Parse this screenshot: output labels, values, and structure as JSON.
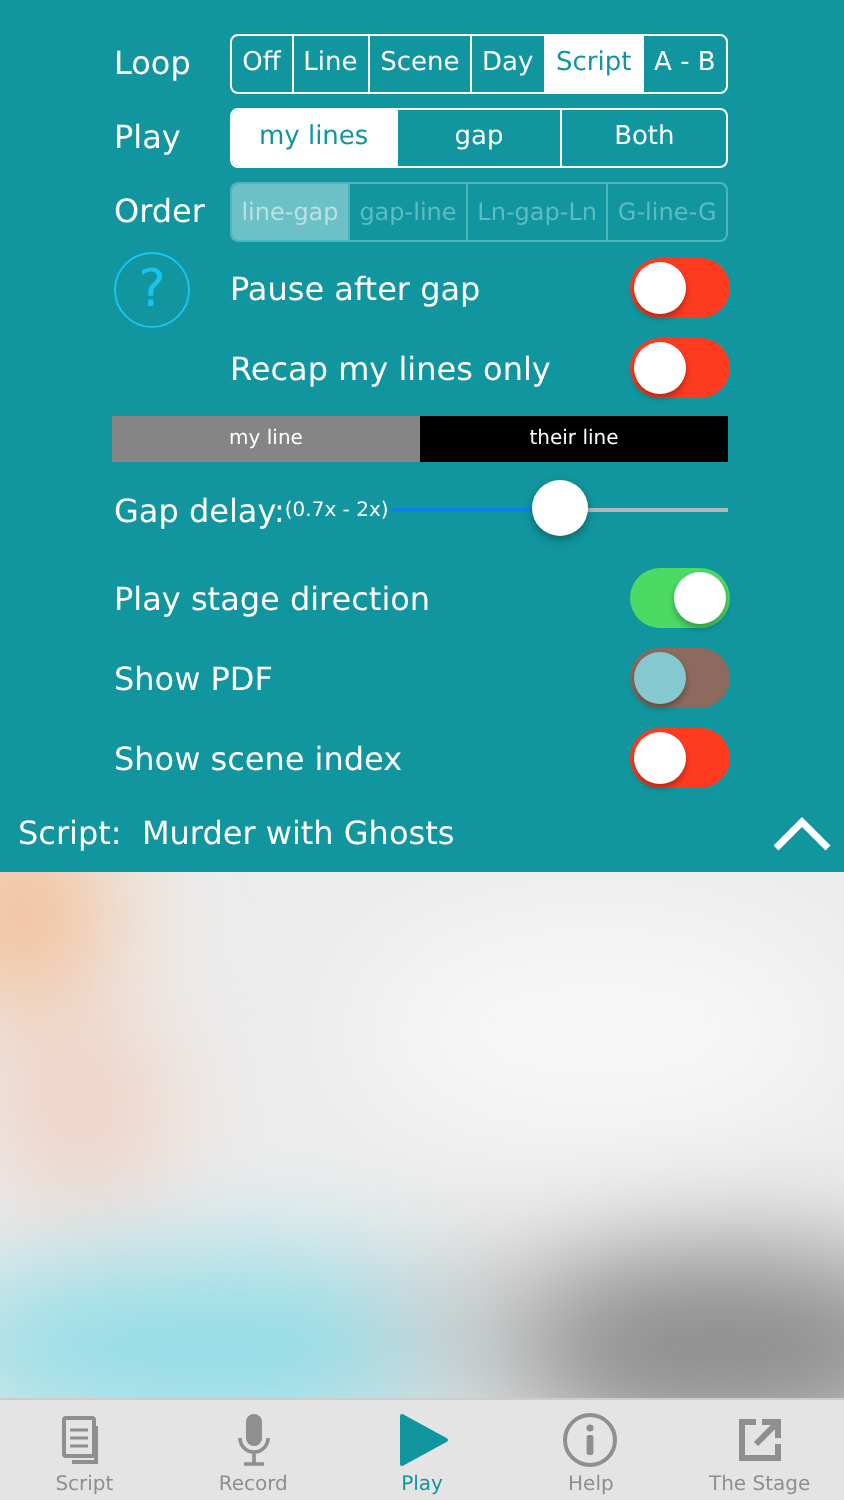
{
  "settings": {
    "loop": {
      "label": "Loop",
      "options": [
        {
          "label": "Off",
          "selected": false
        },
        {
          "label": "Line",
          "selected": false
        },
        {
          "label": "Scene",
          "selected": false
        },
        {
          "label": "Day",
          "selected": false
        },
        {
          "label": "Script",
          "selected": true
        },
        {
          "label": "A - B",
          "selected": false
        }
      ]
    },
    "play": {
      "label": "Play",
      "options": [
        {
          "label": "my lines",
          "selected": true
        },
        {
          "label": "gap",
          "selected": false
        },
        {
          "label": "Both",
          "selected": false
        }
      ]
    },
    "order": {
      "label": "Order",
      "disabled": true,
      "options": [
        {
          "label": "line-gap",
          "selected": true
        },
        {
          "label": "gap-line",
          "selected": false
        },
        {
          "label": "Ln-gap-Ln",
          "selected": false
        },
        {
          "label": "G-line-G",
          "selected": false
        }
      ]
    },
    "help_glyph": "?",
    "gap_toggles": [
      {
        "label": "Pause after gap",
        "on": false,
        "disabled": false
      },
      {
        "label": "Recap my lines only",
        "on": false,
        "disabled": false
      }
    ],
    "line_legend": [
      "my line",
      "their line"
    ],
    "gap_delay": {
      "label": "Gap delay:",
      "range": "(0.7x - 2x)",
      "level": 0.5
    },
    "toggles": [
      {
        "label": "Play stage direction",
        "on": true,
        "disabled": false
      },
      {
        "label": "Show PDF",
        "on": false,
        "disabled": true
      },
      {
        "label": "Show scene index",
        "on": false,
        "disabled": false
      }
    ]
  },
  "script_bar": {
    "prefix": "Script:",
    "title": "Murder with Ghosts"
  },
  "tab_bar": [
    {
      "label": "Script",
      "selected": false
    },
    {
      "label": "Record",
      "selected": false
    },
    {
      "label": "Play",
      "selected": true
    },
    {
      "label": "Help",
      "selected": false
    },
    {
      "label": "The Stage",
      "selected": false
    }
  ]
}
